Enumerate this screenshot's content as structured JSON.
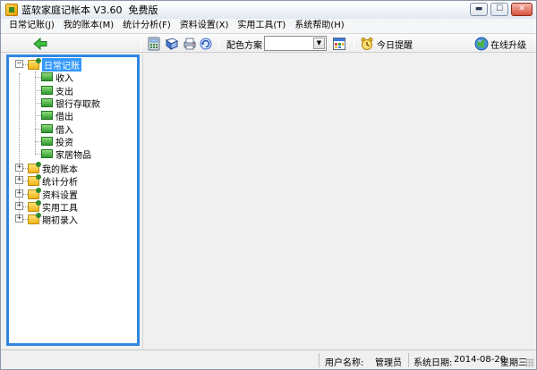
{
  "window": {
    "title": "蓝软家庭记帐本 V3.60  免费版",
    "controls": {
      "minimize": "▬",
      "maximize": "☐",
      "close": "✕"
    }
  },
  "menu": [
    "日常记账(J)",
    "我的账本(M)",
    "统计分析(F)",
    "资料设置(X)",
    "实用工具(T)",
    "系统帮助(H)"
  ],
  "toolbar": {
    "color_scheme_label": "配色方案",
    "color_scheme_value": "",
    "reminder_label": "今日提醒",
    "upgrade_label": "在线升级"
  },
  "tree": {
    "root_selected": "日常记账",
    "root_selected_children": [
      "收入",
      "支出",
      "银行存取款",
      "借出",
      "借入",
      "投资",
      "家居物品"
    ],
    "other_roots": [
      "我的账本",
      "统计分析",
      "资料设置",
      "实用工具",
      "期初录入"
    ],
    "expanded_symbol": "−",
    "collapsed_symbol": "+"
  },
  "status": {
    "user_label": "用户名称:",
    "user_value": "管理员",
    "date_label": "系统日期:",
    "date_value": "2014-08-20",
    "weekday": "星期三"
  },
  "colors": {
    "tree_border": "#2f86e0",
    "selection": "#3399ff",
    "background": "#f0f0f0"
  }
}
